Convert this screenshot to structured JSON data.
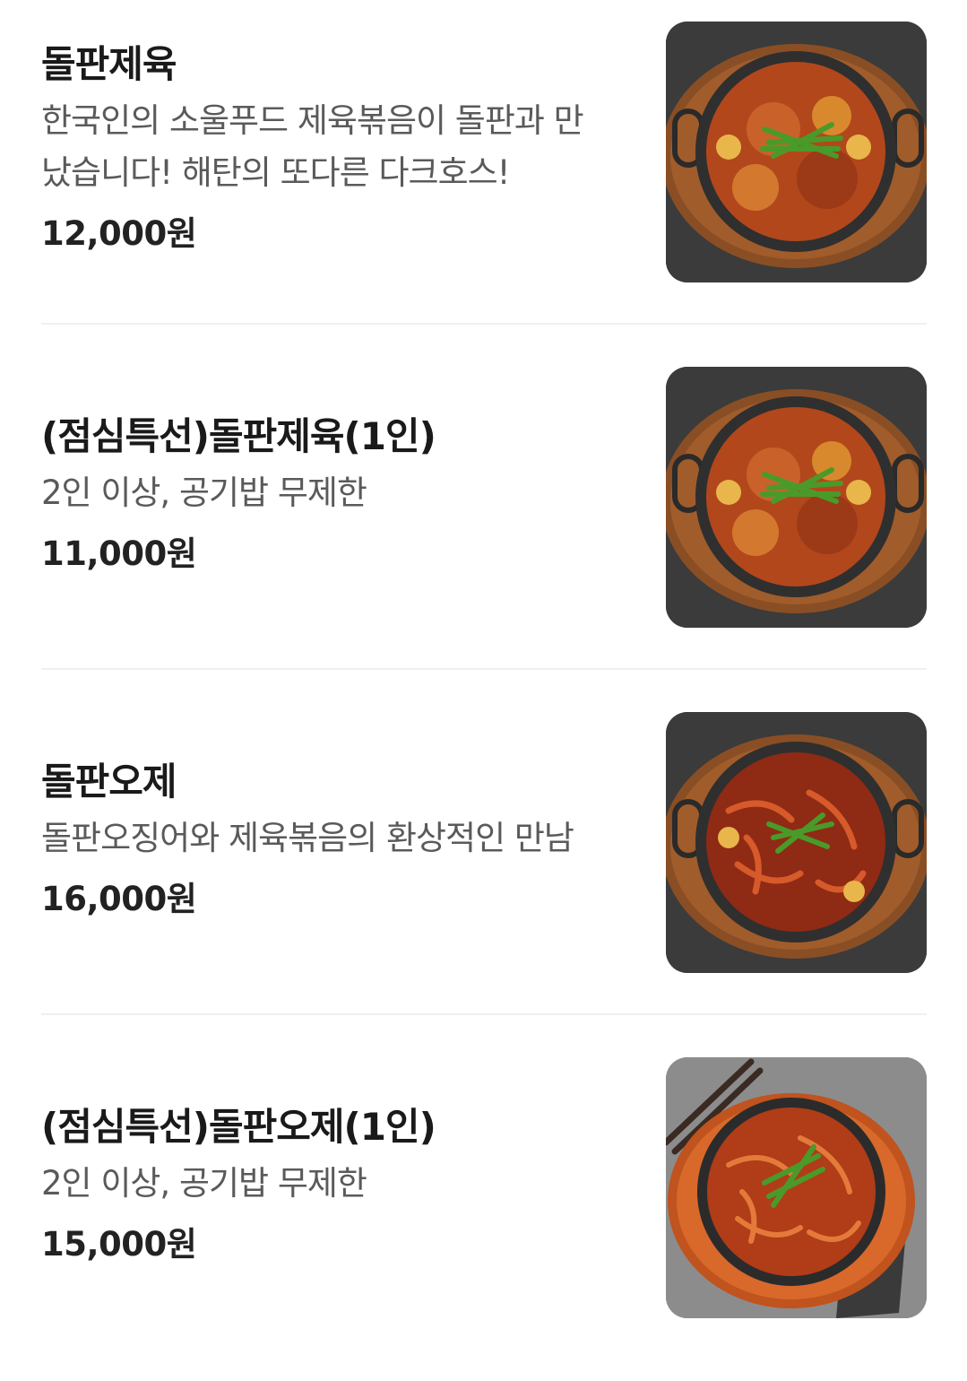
{
  "menu": {
    "items": [
      {
        "name": "돌판제육",
        "description": "한국인의 소울푸드 제육볶음이 돌판과 만\n났습니다! 해탄의 또다른 다크호스!",
        "price": "12,000원",
        "image_icon": "stone-pot-pork-photo"
      },
      {
        "name": "(점심특선)돌판제육(1인)",
        "description": "2인 이상, 공기밥 무제한",
        "price": "11,000원",
        "image_icon": "stone-pot-pork-photo"
      },
      {
        "name": "돌판오제",
        "description": "돌판오징어와 제육볶음의 환상적인 만남",
        "price": "16,000원",
        "image_icon": "stone-pot-squid-pork-photo"
      },
      {
        "name": "(점심특선)돌판오제(1인)",
        "description": "2인 이상, 공기밥 무제한",
        "price": "15,000원",
        "image_icon": "stone-pot-squid-pork-photo"
      }
    ]
  },
  "colors": {
    "divider": "#efefef",
    "name_text": "#1a1a1a",
    "desc_text": "#5a5a5a"
  }
}
